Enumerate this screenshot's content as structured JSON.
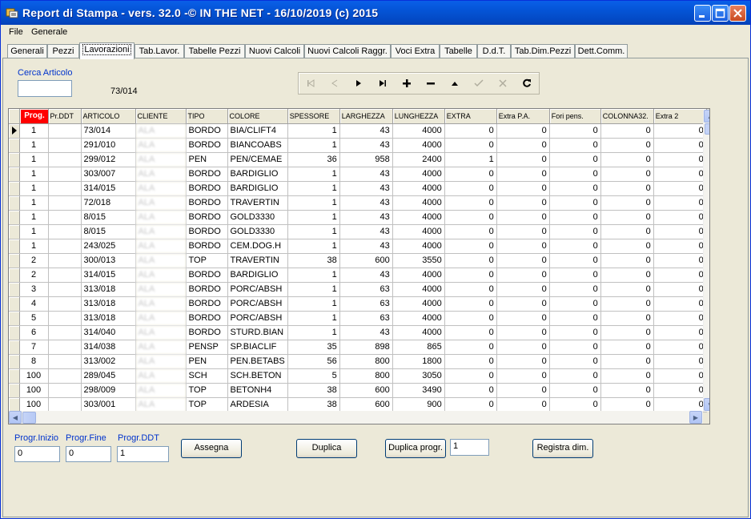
{
  "window": {
    "title": "Report di Stampa - vers. 32.0 -© IN THE NET - 16/10/2019 (c) 2015",
    "icon": "app-icon",
    "controls": [
      "minimize-icon",
      "maximize-icon",
      "close-icon"
    ]
  },
  "menu": {
    "file": "File",
    "generale": "Generale"
  },
  "tabs": [
    "Generali",
    "Pezzi",
    "Lavorazioni",
    "Tab.Lavor.",
    "Tabelle Pezzi",
    "Nuovi Calcoli",
    "Nuovi Calcoli Raggr.",
    "Voci Extra",
    "Tabelle",
    "D.d.T.",
    "Tab.Dim.Pezzi",
    "Dett.Comm."
  ],
  "active_tab": "Lavorazioni",
  "search": {
    "label": "Cerca Articolo",
    "value": "",
    "current_article": "73/014"
  },
  "navigator": {
    "buttons": [
      "first",
      "prior",
      "next",
      "last",
      "insert",
      "delete",
      "edit",
      "post",
      "cancel",
      "refresh"
    ]
  },
  "grid": {
    "columns": [
      "Prog.",
      "Pr.DDT",
      "ARTICOLO",
      "CLIENTE",
      "TIPO",
      "COLORE",
      "SPESSORE",
      "LARGHEZZA",
      "LUNGHEZZA",
      "EXTRA",
      "Extra P.A.",
      "Fori pens.",
      "COLONNA32.",
      "Extra 2"
    ],
    "rows": [
      [
        "1",
        "",
        "73/014",
        "ALA",
        "BORDO",
        "BIA/CLIFT4",
        "1",
        "43",
        "4000",
        "0",
        "0",
        "0",
        "0",
        "0"
      ],
      [
        "1",
        "",
        "291/010",
        "ALA",
        "BORDO",
        "BIANCOABS",
        "1",
        "43",
        "4000",
        "0",
        "0",
        "0",
        "0",
        "0"
      ],
      [
        "1",
        "",
        "299/012",
        "ALA",
        "PEN",
        "PEN/CEMAE",
        "36",
        "958",
        "2400",
        "1",
        "0",
        "0",
        "0",
        "0"
      ],
      [
        "1",
        "",
        "303/007",
        "ALA",
        "BORDO",
        "BARDIGLIO",
        "1",
        "43",
        "4000",
        "0",
        "0",
        "0",
        "0",
        "0"
      ],
      [
        "1",
        "",
        "314/015",
        "ALA",
        "BORDO",
        "BARDIGLIO",
        "1",
        "43",
        "4000",
        "0",
        "0",
        "0",
        "0",
        "0"
      ],
      [
        "1",
        "",
        "72/018",
        "ALA",
        "BORDO",
        "TRAVERTIN",
        "1",
        "43",
        "4000",
        "0",
        "0",
        "0",
        "0",
        "0"
      ],
      [
        "1",
        "",
        "8/015",
        "ALA",
        "BORDO",
        "GOLD3330",
        "1",
        "43",
        "4000",
        "0",
        "0",
        "0",
        "0",
        "0"
      ],
      [
        "1",
        "",
        "8/015",
        "ALA",
        "BORDO",
        "GOLD3330",
        "1",
        "43",
        "4000",
        "0",
        "0",
        "0",
        "0",
        "0"
      ],
      [
        "1",
        "",
        "243/025",
        "ALA",
        "BORDO",
        "CEM.DOG.H",
        "1",
        "43",
        "4000",
        "0",
        "0",
        "0",
        "0",
        "0"
      ],
      [
        "2",
        "",
        "300/013",
        "ALA",
        "TOP",
        "TRAVERTIN",
        "38",
        "600",
        "3550",
        "0",
        "0",
        "0",
        "0",
        "0"
      ],
      [
        "2",
        "",
        "314/015",
        "ALA",
        "BORDO",
        "BARDIGLIO",
        "1",
        "43",
        "4000",
        "0",
        "0",
        "0",
        "0",
        "0"
      ],
      [
        "3",
        "",
        "313/018",
        "ALA",
        "BORDO",
        "PORC/ABSH",
        "1",
        "63",
        "4000",
        "0",
        "0",
        "0",
        "0",
        "0"
      ],
      [
        "4",
        "",
        "313/018",
        "ALA",
        "BORDO",
        "PORC/ABSH",
        "1",
        "63",
        "4000",
        "0",
        "0",
        "0",
        "0",
        "0"
      ],
      [
        "5",
        "",
        "313/018",
        "ALA",
        "BORDO",
        "PORC/ABSH",
        "1",
        "63",
        "4000",
        "0",
        "0",
        "0",
        "0",
        "0"
      ],
      [
        "6",
        "",
        "314/040",
        "ALA",
        "BORDO",
        "STURD.BIAN",
        "1",
        "43",
        "4000",
        "0",
        "0",
        "0",
        "0",
        "0"
      ],
      [
        "7",
        "",
        "314/038",
        "ALA",
        "PENSP",
        "SP.BIACLIF",
        "35",
        "898",
        "865",
        "0",
        "0",
        "0",
        "0",
        "0"
      ],
      [
        "8",
        "",
        "313/002",
        "ALA",
        "PEN",
        "PEN.BETABS",
        "56",
        "800",
        "1800",
        "0",
        "0",
        "0",
        "0",
        "0"
      ],
      [
        "100",
        "",
        "289/045",
        "ALA",
        "SCH",
        "SCH.BETON",
        "5",
        "800",
        "3050",
        "0",
        "0",
        "0",
        "0",
        "0"
      ],
      [
        "100",
        "",
        "298/009",
        "ALA",
        "TOP",
        "BETONH4",
        "38",
        "600",
        "3490",
        "0",
        "0",
        "0",
        "0",
        "0"
      ],
      [
        "100",
        "",
        "303/001",
        "ALA",
        "TOP",
        "ARDESIA",
        "38",
        "600",
        "900",
        "0",
        "0",
        "0",
        "0",
        "0"
      ]
    ]
  },
  "bottom": {
    "progr_inizio_label": "Progr.Inizio",
    "progr_inizio_value": "0",
    "progr_fine_label": "Progr.Fine",
    "progr_fine_value": "0",
    "progr_ddt_label": "Progr.DDT",
    "progr_ddt_value": "1",
    "assegna": "Assegna",
    "duplica": "Duplica",
    "duplica_progr": "Duplica progr.",
    "duplica_progr_value": "1",
    "registra_dim": "Registra dim."
  },
  "colors": {
    "title_bar": "#0454d6",
    "label_blue": "#0033cc",
    "prog_header": "#ff0000"
  }
}
